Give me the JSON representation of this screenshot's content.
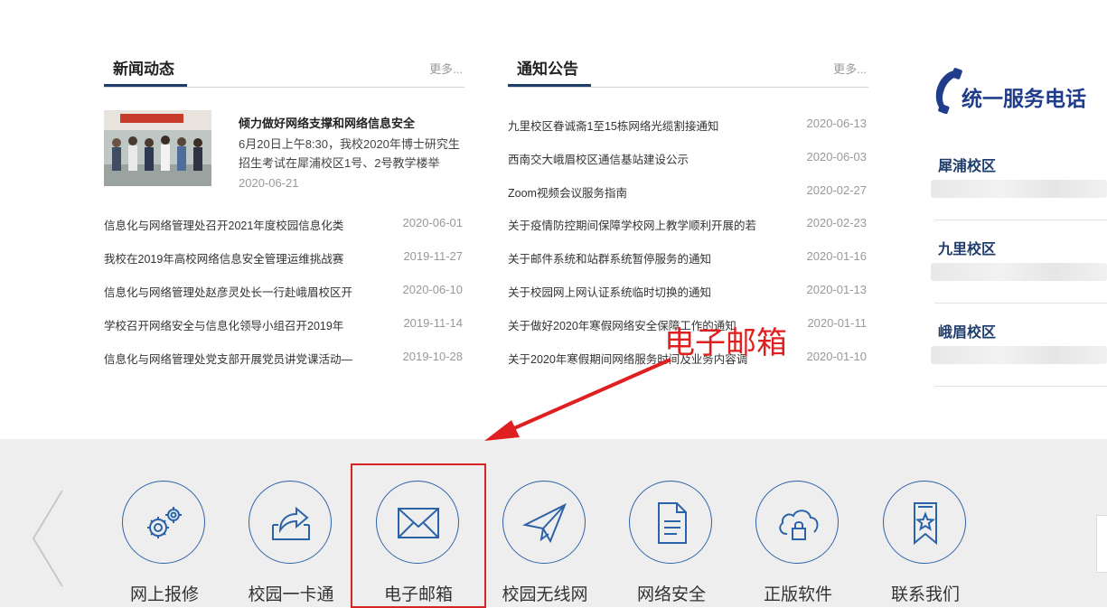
{
  "news": {
    "title": "新闻动态",
    "more": "更多...",
    "feature": {
      "title": "倾力做好网络支撑和网络信息安全",
      "text": "6月20日上午8:30，我校2020年博士研究生招生考试在犀浦校区1号、2号教学楼举",
      "date": "2020-06-21"
    },
    "items": [
      {
        "title": "信息化与网络管理处召开2021年度校园信息化类",
        "date": "2020-06-01"
      },
      {
        "title": "我校在2019年高校网络信息安全管理运维挑战赛",
        "date": "2019-11-27"
      },
      {
        "title": "信息化与网络管理处赵彦灵处长一行赴峨眉校区开",
        "date": "2020-06-10"
      },
      {
        "title": "学校召开网络安全与信息化领导小组召开2019年",
        "date": "2019-11-14"
      },
      {
        "title": "信息化与网络管理处党支部开展党员讲党课活动—",
        "date": "2019-10-28"
      }
    ]
  },
  "notice": {
    "title": "通知公告",
    "more": "更多...",
    "items": [
      {
        "title": "九里校区眷诚斋1至15栋网络光缆割接通知",
        "date": "2020-06-13"
      },
      {
        "title": "西南交大峨眉校区通信基站建设公示",
        "date": "2020-06-03"
      },
      {
        "title": "Zoom视频会议服务指南",
        "date": "2020-02-27"
      },
      {
        "title": "关于疫情防控期间保障学校网上教学顺利开展的若",
        "date": "2020-02-23"
      },
      {
        "title": "关于邮件系统和站群系统暂停服务的通知",
        "date": "2020-01-16"
      },
      {
        "title": "关于校园网上网认证系统临时切换的通知",
        "date": "2020-01-13"
      },
      {
        "title": "关于做好2020年寒假网络安全保障工作的通知",
        "date": "2020-01-11"
      },
      {
        "title": "关于2020年寒假期间网络服务时间及业务内容调",
        "date": "2020-01-10"
      }
    ]
  },
  "service": {
    "title": "统一服务电话",
    "campuses": [
      "犀浦校区",
      "九里校区",
      "峨眉校区"
    ]
  },
  "annotation": "电子邮箱",
  "apps": [
    {
      "label": "网上报修",
      "icon": "gears-icon"
    },
    {
      "label": "校园一卡通",
      "icon": "card-share-icon"
    },
    {
      "label": "电子邮箱",
      "icon": "envelope-icon"
    },
    {
      "label": "校园无线网",
      "icon": "paper-plane-icon"
    },
    {
      "label": "网络安全",
      "icon": "document-icon"
    },
    {
      "label": "正版软件",
      "icon": "cloud-lock-icon"
    },
    {
      "label": "联系我们",
      "icon": "bookmark-star-icon"
    }
  ],
  "colors": {
    "accent": "#2b63a8",
    "title_blue": "#1f3d8b",
    "annotation_red": "#e02020",
    "bottom_bg": "#eeeeee"
  }
}
